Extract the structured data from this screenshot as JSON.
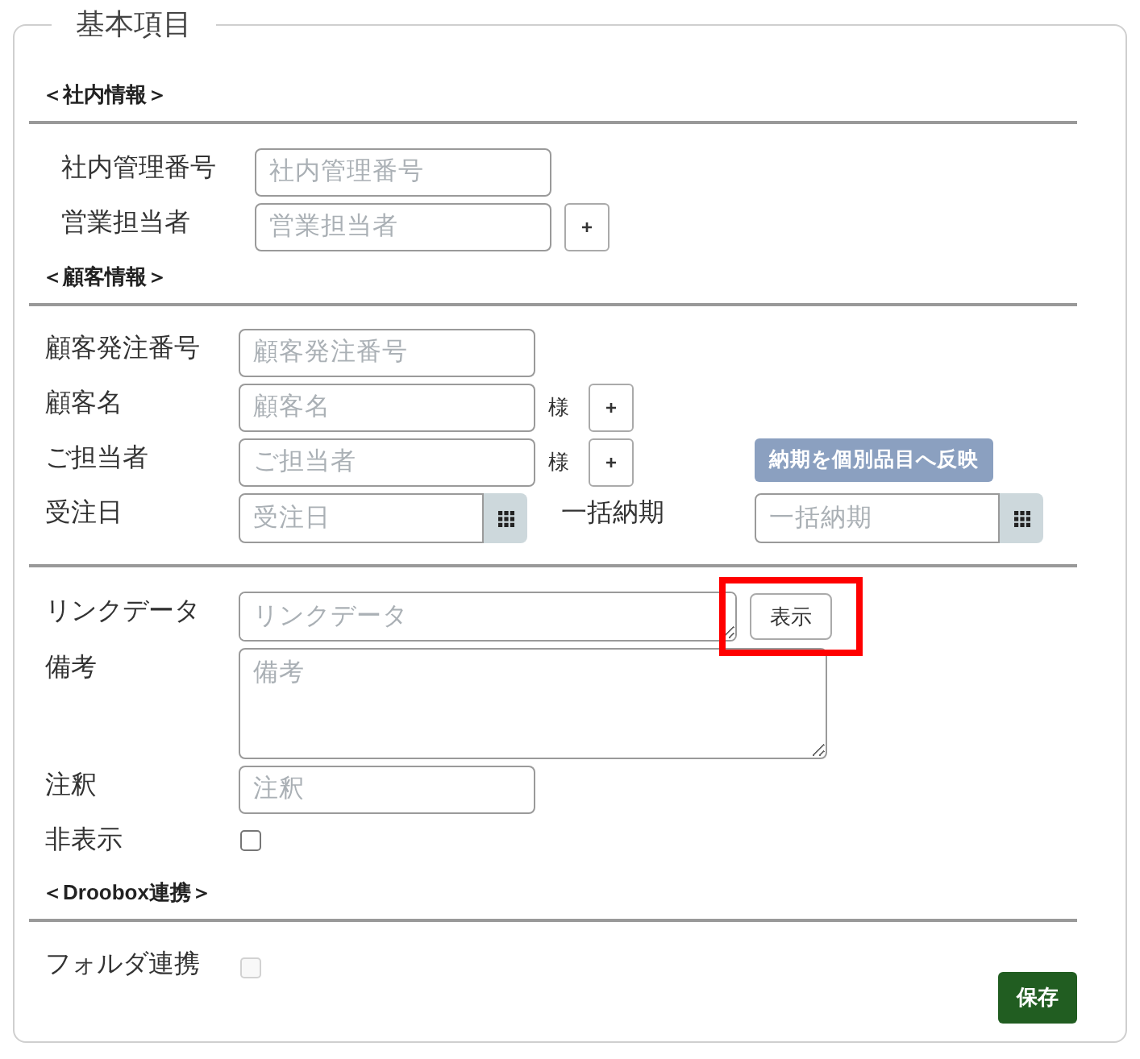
{
  "panel": {
    "title": "基本項目"
  },
  "sections": [
    {
      "heading": "＜社内情報＞",
      "rows": [
        {
          "label": "社内管理番号",
          "field": {
            "kind": "input",
            "placeholder": "社内管理番号"
          }
        },
        {
          "label": "営業担当者",
          "field": {
            "kind": "input",
            "placeholder": "営業担当者"
          },
          "add_button": "+"
        }
      ]
    },
    {
      "heading": "＜顧客情報＞",
      "rows": [
        {
          "label": "顧客発注番号",
          "field": {
            "kind": "input",
            "placeholder": "顧客発注番号"
          }
        },
        {
          "label": "顧客名",
          "field": {
            "kind": "input",
            "placeholder": "顧客名"
          },
          "suffix": "様",
          "add_button": "+"
        },
        {
          "label": "ご担当者",
          "field": {
            "kind": "input",
            "placeholder": "ご担当者"
          },
          "suffix": "様",
          "add_button": "+",
          "side_button": "納期を個別品目へ反映"
        },
        {
          "label": "受注日",
          "field": {
            "kind": "date",
            "placeholder": "受注日"
          },
          "side_field": {
            "label": "一括納期",
            "field": {
              "kind": "date",
              "placeholder": "一括納期"
            }
          }
        }
      ]
    },
    {
      "rows": [
        {
          "label": "リンクデータ",
          "field": {
            "kind": "link",
            "placeholder": "リンクデータ"
          },
          "button": {
            "label": "表示",
            "highlighted": true
          }
        },
        {
          "label": "備考",
          "field": {
            "kind": "textarea",
            "placeholder": "備考"
          }
        },
        {
          "label": "注釈",
          "field": {
            "kind": "input",
            "placeholder": "注釈"
          }
        },
        {
          "label": "非表示",
          "field": {
            "kind": "checkbox",
            "checked": false,
            "disabled": false
          }
        }
      ]
    },
    {
      "heading": "＜Droobox連携＞",
      "rows": [
        {
          "label": "フォルダ連携",
          "field": {
            "kind": "checkbox",
            "checked": false,
            "disabled": true
          }
        }
      ]
    }
  ],
  "save_button": "保存"
}
